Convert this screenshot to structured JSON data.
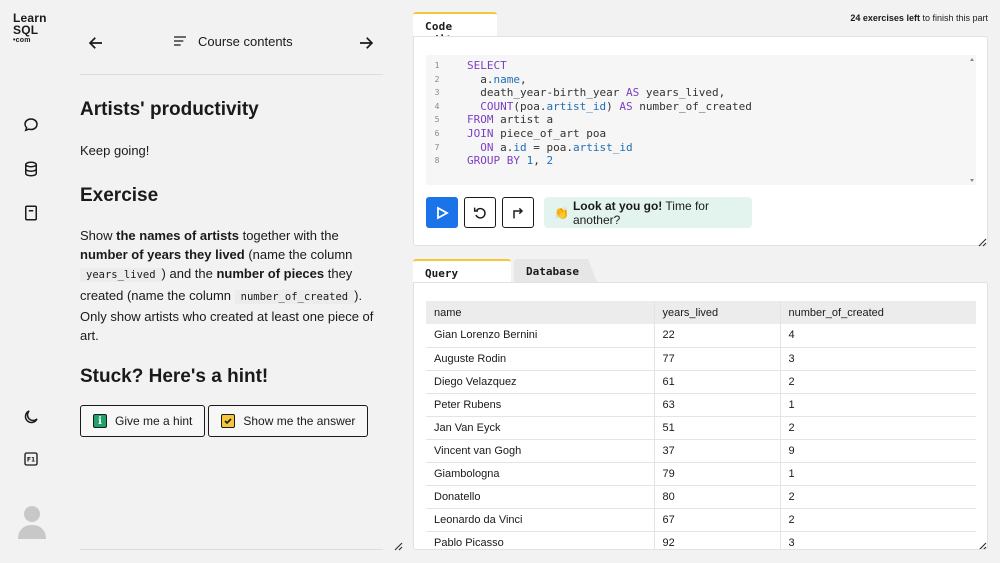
{
  "brand": {
    "line1": "Learn",
    "line2": "SQL",
    "line3": "•com"
  },
  "nav": {
    "course_label": "Course contents"
  },
  "lesson": {
    "title": "Artists' productivity",
    "encouragement": "Keep going!",
    "exercise_heading": "Exercise",
    "instruction": {
      "t1": "Show ",
      "b1": "the names of artists",
      "t2": " together with the ",
      "b2": "number of years they lived",
      "t3": " (name the column ",
      "c1": "years_lived",
      "t4": ") and the ",
      "b3": "number of pieces",
      "t5": " they created (name the column ",
      "c2": "number_of_created",
      "t6": "). Only show artists who created at least one piece of art."
    },
    "hint_heading": "Stuck? Here's a hint!",
    "hint_button": "Give me a hint",
    "answer_button": "Show me the answer"
  },
  "editor": {
    "tab_label": "Code editor",
    "exercises_left_count": "24 exercises left",
    "exercises_left_suffix": " to finish this part",
    "line_numbers": [
      "1",
      "2",
      "3",
      "4",
      "5",
      "6",
      "7",
      "8"
    ],
    "code": {
      "l1": "SELECT",
      "l2a": "  a.",
      "l2b": "name",
      "l2c": ",",
      "l3a": "  death_year-birth_year ",
      "l3b": "AS",
      "l3c": " years_lived,",
      "l4a": "  ",
      "l4b": "COUNT",
      "l4c": "(poa.",
      "l4d": "artist_id",
      "l4e": ") ",
      "l4f": "AS",
      "l4g": " number_of_created",
      "l5a": "FROM",
      "l5b": " artist a",
      "l6a": "JOIN",
      "l6b": " piece_of_art poa",
      "l7a": "  ",
      "l7b": "ON",
      "l7c": " a.",
      "l7d": "id",
      "l7e": " = poa.",
      "l7f": "artist_id",
      "l8a": "GROUP BY",
      "l8b": " ",
      "l8c": "1",
      "l8d": ", ",
      "l8e": "2"
    },
    "toast_emoji": "👏",
    "toast_bold": "Look at you go!",
    "toast_rest": " Time for another?"
  },
  "results": {
    "tabs": [
      "Query results",
      "Database"
    ],
    "columns": [
      "name",
      "years_lived",
      "number_of_created"
    ],
    "rows": [
      [
        "Gian Lorenzo Bernini",
        "22",
        "4"
      ],
      [
        "Auguste Rodin",
        "77",
        "3"
      ],
      [
        "Diego Velazquez",
        "61",
        "2"
      ],
      [
        "Peter Rubens",
        "63",
        "1"
      ],
      [
        "Jan Van Eyck",
        "51",
        "2"
      ],
      [
        "Vincent van Gogh",
        "37",
        "9"
      ],
      [
        "Giambologna",
        "79",
        "1"
      ],
      [
        "Donatello",
        "80",
        "2"
      ],
      [
        "Leonardo da Vinci",
        "67",
        "2"
      ],
      [
        "Pablo Picasso",
        "92",
        "3"
      ]
    ]
  },
  "colors": {
    "accent_blue": "#1a73e8",
    "tab_accent": "#f5c53a",
    "hint_green": "#1fa36b",
    "toast_bg": "#e3f4ee"
  }
}
